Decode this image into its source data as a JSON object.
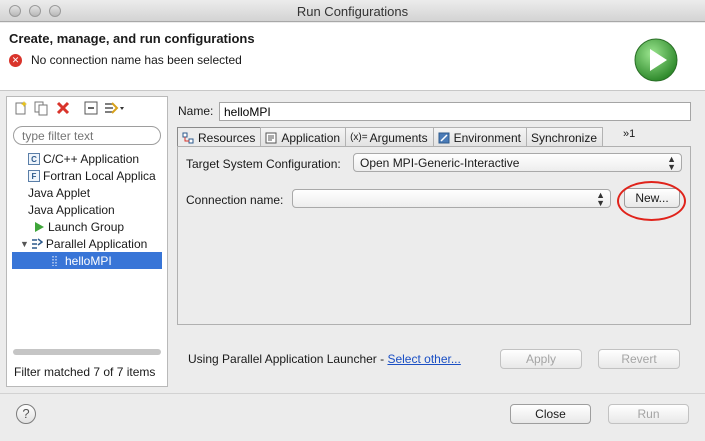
{
  "window": {
    "title": "Run Configurations"
  },
  "header": {
    "heading": "Create, manage, and run configurations",
    "error_message": "No connection name has been selected"
  },
  "left": {
    "filter_placeholder": "type filter text",
    "tree": [
      {
        "label": "C/C++ Application",
        "icon": "c-app-icon"
      },
      {
        "label": "Fortran Local Applica",
        "icon": "fortran-app-icon"
      },
      {
        "label": "Java Applet"
      },
      {
        "label": "Java Application"
      },
      {
        "label": "Launch Group",
        "icon": "launch-group-icon"
      },
      {
        "label": "Parallel Application",
        "icon": "parallel-app-icon",
        "expanded": true
      },
      {
        "label": "helloMPI",
        "icon": "parallel-config-icon",
        "selected": true
      }
    ],
    "footer": "Filter matched 7 of 7 items"
  },
  "config": {
    "name_label": "Name:",
    "name_value": "helloMPI",
    "tabs": [
      {
        "label": "Resources",
        "active": true
      },
      {
        "label": "Application"
      },
      {
        "label": "Arguments",
        "prefix": "(x)="
      },
      {
        "label": "Environment"
      },
      {
        "label": "Synchronize"
      }
    ],
    "tab_overflow": "»1",
    "target_system_label": "Target System Configuration:",
    "target_system_value": "Open MPI-Generic-Interactive",
    "connection_label": "Connection name:",
    "connection_value": "",
    "new_button": "New...",
    "launcher_text": "Using Parallel Application Launcher - ",
    "select_other_link": "Select other...",
    "apply_button": "Apply",
    "revert_button": "Revert"
  },
  "footer": {
    "help": "?",
    "close_button": "Close",
    "run_button": "Run"
  },
  "colors": {
    "error": "#d9342b",
    "selection": "#3875d7",
    "highlight_circle": "#e0231b",
    "run_green": "#3fa53a"
  }
}
